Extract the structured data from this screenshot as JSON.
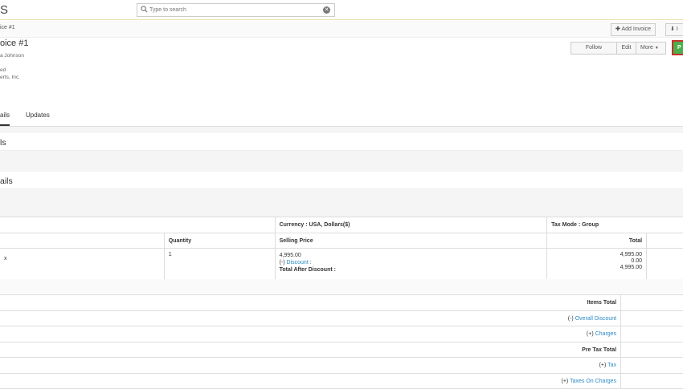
{
  "header": {
    "app_title": "S",
    "search_placeholder": "Type to search"
  },
  "breadcrumb": {
    "text": "ice #1"
  },
  "toolbar": {
    "add_invoice": "Add Invoice",
    "import_partial": "I"
  },
  "record": {
    "title": "oice #1",
    "owner": "a Johnson",
    "status": "ed",
    "organization": "erts, Inc."
  },
  "actions": {
    "follow": "Follow",
    "edit": "Edit",
    "more": "More",
    "primary_partial": "P"
  },
  "tabs": [
    {
      "label": "ails"
    },
    {
      "label": "Updates"
    }
  ],
  "sections": [
    {
      "title": "ls"
    },
    {
      "title": "ails"
    }
  ],
  "items_table": {
    "currency": "Currency : USA, Dollars($)",
    "tax_mode": "Tax Mode : Group",
    "headers": {
      "quantity": "Quantity",
      "selling_price": "Selling Price",
      "total": "Total"
    },
    "row": {
      "product_partial": "x",
      "quantity": "1",
      "price": "4,995.00",
      "discount_prefix": "(-)",
      "discount_label": "Discount",
      "discount_colon": ":",
      "after_discount_label": "Total After Discount :",
      "total_price": "4,995.00",
      "total_discount": "0.00",
      "total_after": "4,995.00"
    }
  },
  "totals": [
    {
      "prefix": "",
      "label": "Items Total",
      "link": false
    },
    {
      "prefix": "(-)",
      "label": "Overall Discount",
      "link": true
    },
    {
      "prefix": "(+)",
      "label": "Charges",
      "link": true
    },
    {
      "prefix": "",
      "label": "Pre Tax Total",
      "link": false
    },
    {
      "prefix": "(+)",
      "label": "Tax",
      "link": true
    },
    {
      "prefix": "(+)",
      "label": "Taxes On Charges",
      "link": true
    }
  ],
  "colors": {
    "primary_green": "#4cae4c",
    "primary_border": "#c9302c",
    "link": "#2a8ac4"
  }
}
